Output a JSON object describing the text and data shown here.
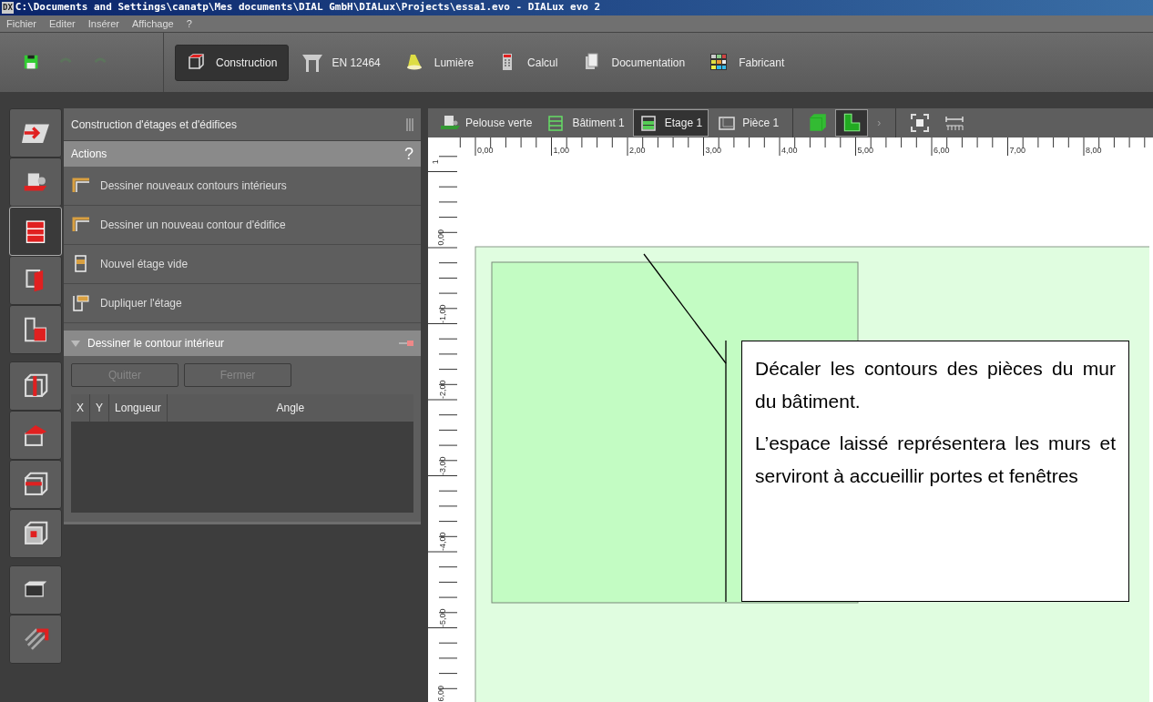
{
  "window": {
    "icon_text": "DX",
    "title": "C:\\Documents and Settings\\canatp\\Mes documents\\DIAL GmbH\\DIALux\\Projects\\essa1.evo - DIALux evo 2"
  },
  "menu": [
    "Fichier",
    "Editer",
    "Insérer",
    "Affichage",
    "?"
  ],
  "quick_tools": [
    {
      "kind": "save",
      "disabled": false
    },
    {
      "kind": "undo",
      "disabled": true
    },
    {
      "kind": "redo",
      "disabled": true
    }
  ],
  "mode_tabs": [
    {
      "label": "Construction",
      "kind": "construction",
      "selected": true
    },
    {
      "label": "EN 12464",
      "kind": "table",
      "selected": false
    },
    {
      "label": "Lumière",
      "kind": "lamp",
      "selected": false
    },
    {
      "label": "Calcul",
      "kind": "calculator",
      "selected": false
    },
    {
      "label": "Documentation",
      "kind": "pages",
      "selected": false
    },
    {
      "label": "Fabricant",
      "kind": "catalog",
      "selected": false
    }
  ],
  "side_tool_groups": [
    [
      {
        "kind": "import",
        "selected": false
      },
      {
        "kind": "object",
        "selected": false
      },
      {
        "kind": "floors",
        "selected": true
      },
      {
        "kind": "wall",
        "selected": false
      },
      {
        "kind": "room",
        "selected": false
      }
    ],
    [
      {
        "kind": "column",
        "selected": false
      },
      {
        "kind": "roof",
        "selected": false
      },
      {
        "kind": "ceiling",
        "selected": false
      },
      {
        "kind": "opening",
        "selected": false
      }
    ],
    [
      {
        "kind": "furniture",
        "selected": false
      },
      {
        "kind": "hatch",
        "selected": false
      }
    ]
  ],
  "panel": {
    "title": "Construction d'étages et d'édifices",
    "actions_header": "Actions",
    "help": "?",
    "actions": [
      {
        "label": "Dessiner nouveaux contours intérieurs",
        "kind": "contour"
      },
      {
        "label": "Dessiner un nouveau contour d'édifice",
        "kind": "contour"
      },
      {
        "label": "Nouvel étage vide",
        "kind": "floor"
      },
      {
        "label": "Dupliquer l'étage",
        "kind": "duplicate"
      }
    ],
    "section": {
      "title": "Dessiner le contour intérieur",
      "expanded": true,
      "buttons": [
        {
          "label": "Quitter",
          "disabled": true
        },
        {
          "label": "Fermer",
          "disabled": true
        }
      ],
      "table": {
        "columns": [
          "X",
          "Y",
          "Longueur",
          "Angle"
        ]
      }
    }
  },
  "view_toolbar": {
    "breadcrumbs": [
      {
        "label": "Pelouse verte",
        "kind": "terrain",
        "selected": false
      },
      {
        "label": "Bâtiment 1",
        "kind": "building",
        "selected": false
      },
      {
        "label": "Etage 1",
        "kind": "storey",
        "selected": true
      },
      {
        "label": "Pièce 1",
        "kind": "room",
        "selected": false
      }
    ],
    "modes": [
      {
        "kind": "solid",
        "selected": false
      },
      {
        "kind": "plan",
        "selected": true
      }
    ],
    "more": "›",
    "tools": [
      {
        "kind": "fit"
      },
      {
        "kind": "measure"
      }
    ]
  },
  "ruler": {
    "x_labels": [
      "0,00",
      "1,00",
      "2,00",
      "3,00",
      "4,00",
      "5,00",
      "6,00",
      "7,00",
      "8,00"
    ],
    "y_labels": [
      "1",
      "0,00",
      "-1,00",
      "-2,00",
      "-3,00",
      "-4,00",
      "-5,00",
      "6,00"
    ]
  },
  "callout": {
    "paragraphs": [
      "Décaler les contours des pièces du mur du bâtiment.",
      "L’espace laissé représentera les murs et serviront à accueillir portes et fenêtres"
    ]
  }
}
